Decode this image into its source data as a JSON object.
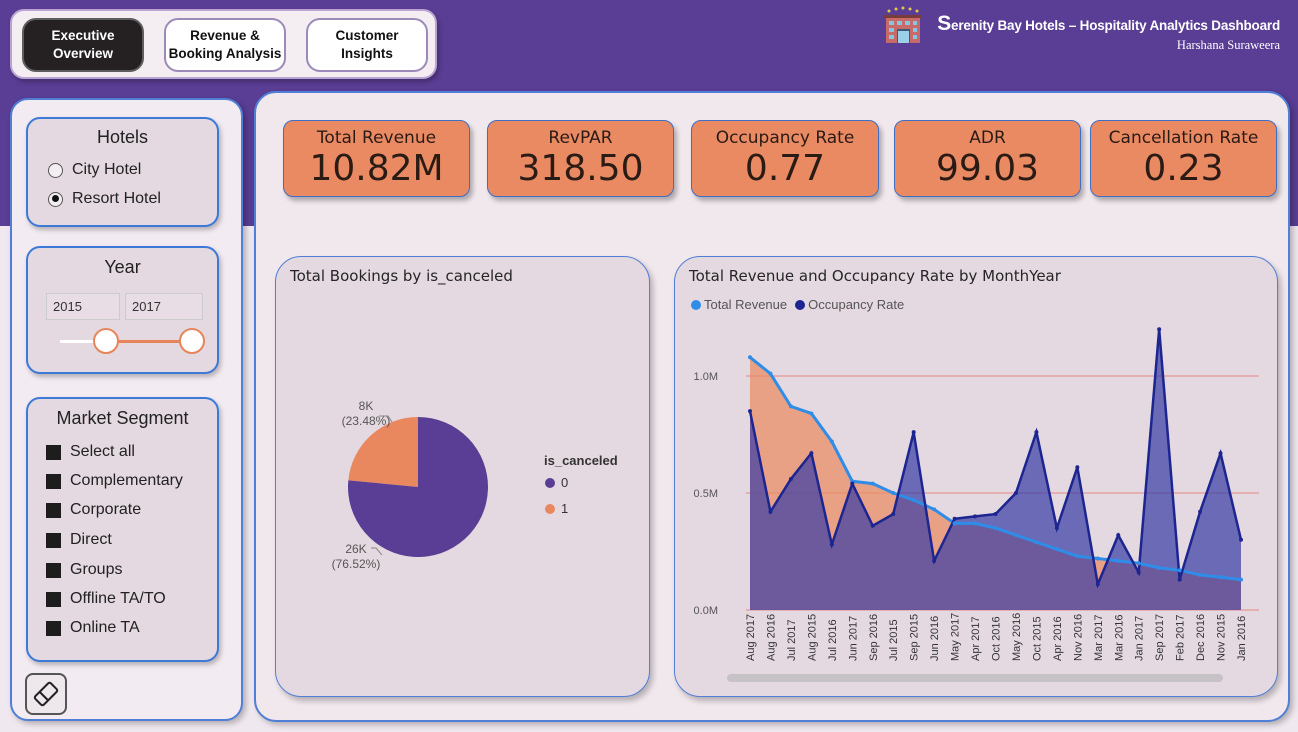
{
  "nav": {
    "tabs": [
      {
        "label": "Executive\nOverview",
        "active": true
      },
      {
        "label": "Revenue &\nBooking Analysis",
        "active": false
      },
      {
        "label": "Customer\nInsights",
        "active": false
      }
    ]
  },
  "brand": {
    "title_initial": "S",
    "title_rest": "erenity Bay Hotels – Hospitality Analytics Dashboard",
    "author": "Harshana Suraweera",
    "logo_icon": "hotel-building-icon"
  },
  "filters": {
    "hotels": {
      "title": "Hotels",
      "options": [
        {
          "label": "City Hotel",
          "selected": false
        },
        {
          "label": "Resort Hotel",
          "selected": true
        }
      ]
    },
    "year": {
      "title": "Year",
      "from": "2015",
      "to": "2017"
    },
    "market_segment": {
      "title": "Market Segment",
      "options": [
        "Select all",
        "Complementary",
        "Corporate",
        "Direct",
        "Groups",
        "Offline TA/TO",
        "Online TA"
      ]
    },
    "clear_icon": "eraser-icon"
  },
  "kpis": [
    {
      "label": "Total Revenue",
      "value": "10.82M"
    },
    {
      "label": "RevPAR",
      "value": "318.50"
    },
    {
      "label": "Occupancy Rate",
      "value": "0.77"
    },
    {
      "label": "ADR",
      "value": "99.03"
    },
    {
      "label": "Cancellation Rate",
      "value": "0.23"
    }
  ],
  "colors": {
    "accent_orange": "#ea8a63",
    "purple": "#5a3d94",
    "pie_zero": "#5a3d94",
    "pie_one": "#e9885f",
    "revenue_line": "#2f8de8",
    "occupancy_line": "#1c2590"
  },
  "chart_data": [
    {
      "type": "pie",
      "title": "Total Bookings by is_canceled",
      "legend_title": "is_canceled",
      "legend_position": "right",
      "categories": [
        "0",
        "1"
      ],
      "values": [
        26000,
        8000
      ],
      "labels": [
        {
          "value": "26K",
          "percent": "(76.52%)"
        },
        {
          "value": "8K",
          "percent": "(23.48%)"
        }
      ],
      "percents": [
        76.52,
        23.48
      ]
    },
    {
      "type": "area",
      "title": "Total Revenue and Occupancy Rate by MonthYear",
      "legend_position": "top-left",
      "categories": [
        "Aug 2017",
        "Aug 2016",
        "Jul 2017",
        "Aug 2015",
        "Jul 2016",
        "Jun 2017",
        "Sep 2016",
        "Jul 2015",
        "Sep 2015",
        "Jun 2016",
        "May 2017",
        "Apr 2017",
        "Oct 2016",
        "May 2016",
        "Oct 2015",
        "Apr 2016",
        "Nov 2016",
        "Mar 2017",
        "Mar 2016",
        "Jan 2017",
        "Sep 2017",
        "Feb 2017",
        "Dec 2016",
        "Nov 2015",
        "Jan 2016"
      ],
      "y_ticks": [
        "0.0M",
        "0.5M",
        "1.0M"
      ],
      "ylim": [
        0,
        1.25
      ],
      "grid": true,
      "series": [
        {
          "name": "Total Revenue",
          "values": [
            1.08,
            1.01,
            0.87,
            0.84,
            0.72,
            0.55,
            0.54,
            0.5,
            0.47,
            0.43,
            0.37,
            0.37,
            0.35,
            0.32,
            0.29,
            0.26,
            0.23,
            0.22,
            0.21,
            0.2,
            0.18,
            0.17,
            0.15,
            0.14,
            0.13
          ]
        },
        {
          "name": "Occupancy Rate",
          "values": [
            0.85,
            0.42,
            0.56,
            0.67,
            0.28,
            0.54,
            0.36,
            0.41,
            0.76,
            0.21,
            0.39,
            0.4,
            0.41,
            0.5,
            0.76,
            0.35,
            0.61,
            0.11,
            0.32,
            0.16,
            1.2,
            0.13,
            0.42,
            0.67,
            0.3
          ]
        }
      ]
    }
  ]
}
